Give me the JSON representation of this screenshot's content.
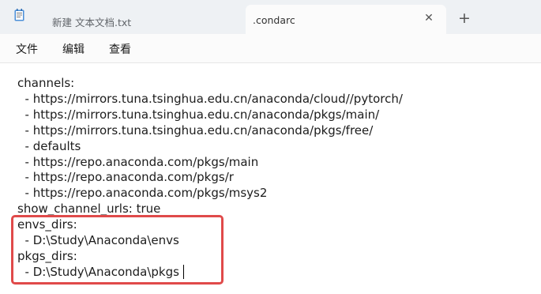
{
  "tabs": [
    {
      "label": "新建 文本文档.txt",
      "icon": "notepad-icon",
      "active": false
    },
    {
      "label": ".condarc",
      "active": true,
      "close_icon": "close-icon"
    }
  ],
  "new_tab_icon": "plus-icon",
  "menu": {
    "file": "文件",
    "edit": "编辑",
    "view": "查看"
  },
  "editor": {
    "lines": [
      "channels:",
      "  - https://mirrors.tuna.tsinghua.edu.cn/anaconda/cloud//pytorch/",
      "  - https://mirrors.tuna.tsinghua.edu.cn/anaconda/pkgs/main/",
      "  - https://mirrors.tuna.tsinghua.edu.cn/anaconda/pkgs/free/",
      "  - defaults",
      "  - https://repo.anaconda.com/pkgs/main",
      "  - https://repo.anaconda.com/pkgs/r",
      "  - https://repo.anaconda.com/pkgs/msys2",
      "show_channel_urls: true",
      "envs_dirs:",
      "  - D:\\Study\\Anaconda\\envs",
      "pkgs_dirs:",
      "  - D:\\Study\\Anaconda\\pkgs"
    ]
  },
  "colors": {
    "highlight_border": "#e04a4a",
    "tabbar_bg": "#eef1f4"
  }
}
